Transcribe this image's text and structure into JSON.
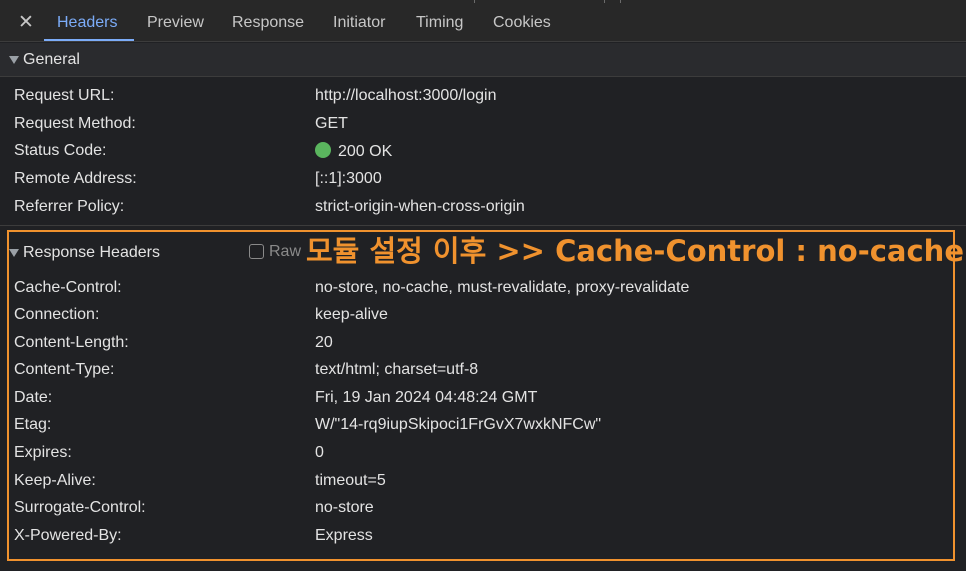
{
  "tabs": {
    "close_label": "✕",
    "items": [
      "Headers",
      "Preview",
      "Response",
      "Initiator",
      "Timing",
      "Cookies"
    ],
    "active": "Headers"
  },
  "general": {
    "title": "General",
    "rows": [
      {
        "key": "Request URL:",
        "value": "http://localhost:3000/login"
      },
      {
        "key": "Request Method:",
        "value": "GET"
      },
      {
        "key": "Status Code:",
        "value": "200 OK"
      },
      {
        "key": "Remote Address:",
        "value": "[::1]:3000"
      },
      {
        "key": "Referrer Policy:",
        "value": "strict-origin-when-cross-origin"
      }
    ]
  },
  "response_headers": {
    "title": "Response Headers",
    "raw_label": "Raw",
    "raw_checked": false,
    "annotation": "모듈 설정 이후 >> Cache-Control : no-cache",
    "rows": [
      {
        "key": "Cache-Control:",
        "value": "no-store, no-cache, must-revalidate, proxy-revalidate"
      },
      {
        "key": "Connection:",
        "value": "keep-alive"
      },
      {
        "key": "Content-Length:",
        "value": "20"
      },
      {
        "key": "Content-Type:",
        "value": "text/html; charset=utf-8"
      },
      {
        "key": "Date:",
        "value": "Fri, 19 Jan 2024 04:48:24 GMT"
      },
      {
        "key": "Etag:",
        "value": "W/\"14-rq9iupSkipoci1FrGvX7wxkNFCw\""
      },
      {
        "key": "Expires:",
        "value": "0"
      },
      {
        "key": "Keep-Alive:",
        "value": "timeout=5"
      },
      {
        "key": "Surrogate-Control:",
        "value": "no-store"
      },
      {
        "key": "X-Powered-By:",
        "value": "Express"
      }
    ]
  },
  "colors": {
    "background": "#202124",
    "active_tab": "#7cacf8",
    "status_ok": "#5ab55e",
    "annotation": "#f0922e"
  }
}
